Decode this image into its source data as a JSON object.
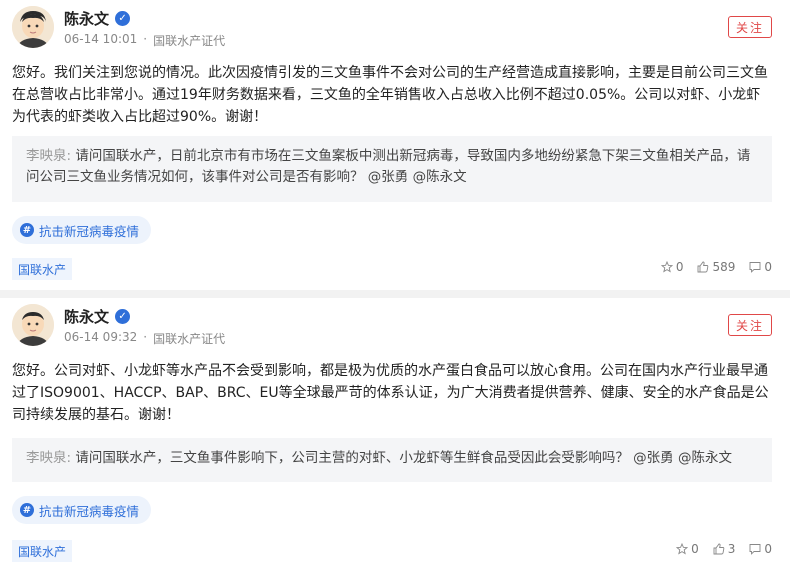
{
  "colors": {
    "accent_red": "#e04848",
    "accent_blue": "#2f6fd9",
    "quote_bg": "#f4f5f7"
  },
  "posts": [
    {
      "author": "陈永文",
      "time": "06-14 10:01",
      "separator": "·",
      "source": "国联水产证代",
      "follow_label": "关注",
      "reply": "您好。我们关注到您说的情况。此次因疫情引发的三文鱼事件不会对公司的生产经营造成直接影响，主要是目前公司三文鱼在总营收占比非常小。通过19年财务数据来看，三文鱼的全年销售收入占总收入比例不超过0.05%。公司以对虾、小龙虾为代表的虾类收入占比超过90%。谢谢！",
      "question_asker": "李映泉:",
      "question": "请问国联水产，日前北京市有市场在三文鱼案板中测出新冠病毒，导致国内多地纷纷紧急下架三文鱼相关产品，请问公司三文鱼业务情况如何，该事件对公司是否有影响？ @张勇 @陈永文",
      "topic_icon": "#",
      "topic": "抗击新冠病毒疫情",
      "stock_tag": "国联水产",
      "star_count": "0",
      "like_count": "589",
      "comment_count": "0"
    },
    {
      "author": "陈永文",
      "time": "06-14 09:32",
      "separator": "·",
      "source": "国联水产证代",
      "follow_label": "关注",
      "reply": "您好。公司对虾、小龙虾等水产品不会受到影响，都是极为优质的水产蛋白食品可以放心食用。公司在国内水产行业最早通过了ISO9001、HACCP、BAP、BRC、EU等全球最严苛的体系认证，为广大消费者提供营养、健康、安全的水产食品是公司持续发展的基石。谢谢！",
      "question_asker": "李映泉:",
      "question": "请问国联水产，三文鱼事件影响下，公司主营的对虾、小龙虾等生鲜食品受因此会受影响吗？ @张勇 @陈永文",
      "topic_icon": "#",
      "topic": "抗击新冠病毒疫情",
      "stock_tag": "国联水产",
      "star_count": "0",
      "like_count": "3",
      "comment_count": "0"
    }
  ],
  "icons": {
    "verified": "verified-check-icon",
    "star": "star-icon",
    "like": "thumbs-up-icon",
    "comment": "comment-icon"
  }
}
